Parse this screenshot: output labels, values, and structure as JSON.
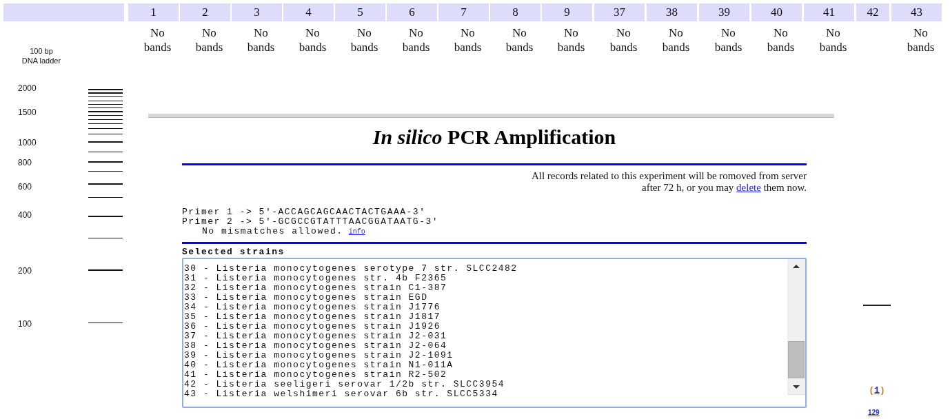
{
  "gel": {
    "ladder_label": [
      "100 bp",
      "DNA ladder"
    ],
    "ladder_marks": [
      "2000",
      "1500",
      "1000",
      "800",
      "600",
      "400",
      "200",
      "100"
    ],
    "lanes": [
      {
        "number": "1",
        "result": "No bands"
      },
      {
        "number": "2",
        "result": "No bands"
      },
      {
        "number": "3",
        "result": "No bands"
      },
      {
        "number": "4",
        "result": "No bands"
      },
      {
        "number": "5",
        "result": "No bands"
      },
      {
        "number": "6",
        "result": "No bands"
      },
      {
        "number": "7",
        "result": "No bands"
      },
      {
        "number": "8",
        "result": "No bands"
      },
      {
        "number": "9",
        "result": "No bands"
      },
      {
        "number": "37",
        "result": "No bands"
      },
      {
        "number": "38",
        "result": "No bands"
      },
      {
        "number": "39",
        "result": "No bands"
      },
      {
        "number": "40",
        "result": "No bands"
      },
      {
        "number": "41",
        "result": "No bands"
      },
      {
        "number": "42",
        "bands": [
          {
            "prefix": "(",
            "count": "1",
            "suffix": ")",
            "size": "129"
          }
        ]
      },
      {
        "number": "43",
        "result": "No bands"
      }
    ]
  },
  "pcr_page": {
    "title": "*In silico* PCR Amplification",
    "notice": {
      "line_1": "All records related to this experiment will be romoved from server",
      "line_2_before": "after 72 h, or you may",
      "link": "delete",
      "line_2_after": "them now."
    },
    "primers": [
      "Primer 1 -> 5'-ACCAGCAGCAACTACTGAAA-3'",
      "Primer 2 -> 5'-GCGCCGTATTTAACGGATAATG-3'"
    ],
    "mismatch_note": "No mismatches allowed.",
    "info_link": "info",
    "selected_strains": {
      "label": "Selected strains",
      "items": [
        "30 - Listeria monocytogenes serotype 7 str. SLCC2482",
        "31 - Listeria monocytogenes str. 4b F2365",
        "32 - Listeria monocytogenes strain C1-387",
        "33 - Listeria monocytogenes strain EGD",
        "34 - Listeria monocytogenes strain J1776",
        "35 - Listeria monocytogenes strain J1817",
        "36 - Listeria monocytogenes strain J1926",
        "37 - Listeria monocytogenes strain J2-031",
        "38 - Listeria monocytogenes strain J2-064",
        "39 - Listeria monocytogenes strain J2-1091",
        "40 - Listeria monocytogenes strain N1-011A",
        "41 - Listeria monocytogenes strain R2-502",
        "42 - Listeria seeligeri serovar 1/2b str. SLCC3954",
        "43 - Listeria welshimeri serovar 6b str. SLCC5334"
      ]
    }
  }
}
